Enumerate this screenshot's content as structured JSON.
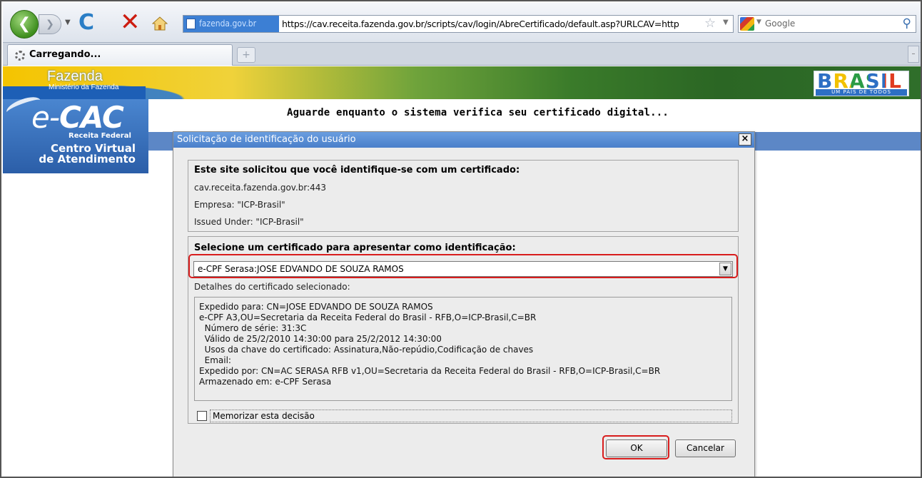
{
  "browser": {
    "site_identity": "fazenda.gov.br",
    "url": "https://cav.receita.fazenda.gov.br/scripts/cav/login/AbreCertificado/default.asp?URLCAV=http",
    "search_placeholder": "Google",
    "tab_label": "Carregando..."
  },
  "header": {
    "fazenda": "Fazenda",
    "ministerio": "Ministério da Fazenda",
    "brasil": "BRASIL",
    "brasil_tagline": "UM PAÍS DE TODOS",
    "ecac": "CAC",
    "ecac_prefix": "e-",
    "receita": "Receita Federal",
    "centro_virtual": "Centro Virtual",
    "atendimento": "de Atendimento",
    "wait_message": "Aguarde enquanto o sistema verifica seu certificado digital..."
  },
  "dialog": {
    "title": "Solicitação de identificação do usuário",
    "close": "×",
    "request_heading": "Este site solicitou que você identifique-se com um certificado:",
    "site": "cav.receita.fazenda.gov.br:443",
    "empresa": "Empresa: \"ICP-Brasil\"",
    "issued_under": "Issued Under: \"ICP-Brasil\"",
    "select_heading": "Selecione um certificado para apresentar como identificação:",
    "selected_certificate": "e-CPF Serasa:JOSE EDVANDO DE SOUZA RAMOS",
    "details_label": "Detalhes do certificado selecionado:",
    "details_lines": [
      "Expedido para: CN=JOSE EDVANDO DE SOUZA RAMOS",
      "e-CPF A3,OU=Secretaria da Receita Federal do Brasil - RFB,O=ICP-Brasil,C=BR",
      "  Número de série: 31:3C",
      "  Válido de 25/2/2010 14:30:00 para 25/2/2012 14:30:00",
      "  Usos da chave do certificado: Assinatura,Não-repúdio,Codificação de chaves",
      "  Email:",
      "Expedido por: CN=AC SERASA RFB v1,OU=Secretaria da Receita Federal do Brasil - RFB,O=ICP-Brasil,C=BR",
      "Armazenado em: e-CPF Serasa"
    ],
    "remember_label": "Memorizar esta decisão",
    "ok_label": "OK",
    "cancel_label": "Cancelar"
  },
  "colors": {
    "highlight": "#d81d1d",
    "title_bar": "#4a7fca"
  }
}
